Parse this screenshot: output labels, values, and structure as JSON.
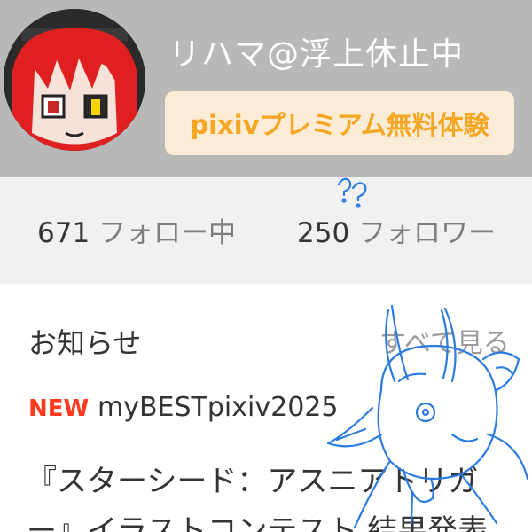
{
  "profile": {
    "username": "リハマ@浮上休止中",
    "premium_button": "pixivプレミアム無料体験"
  },
  "follow_stats": {
    "following_count": "671",
    "following_label": "フォロー中",
    "followers_count": "250",
    "followers_label": "フォロワー"
  },
  "news": {
    "title": "お知らせ",
    "see_all": "すべて見る",
    "item": {
      "badge": "NEW",
      "headline": "myBESTpixiv2025",
      "body": "『スターシード：アスニアトリガー』イラストコンテスト 結果発表"
    }
  },
  "colors": {
    "header_bg": "#b8b8b8",
    "premium_bg": "#fdecd5",
    "premium_text": "#f5a623",
    "new_badge": "#ff3a1f",
    "doodle_stroke": "#2b7be0"
  },
  "icons": [
    "avatar-image",
    "sketch-doodle"
  ]
}
